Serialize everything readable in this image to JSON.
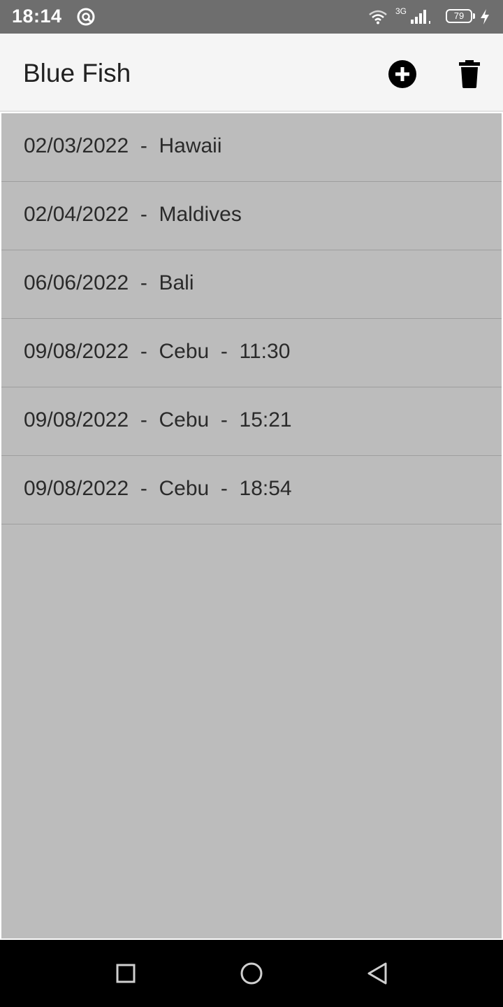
{
  "status_bar": {
    "time": "18:14",
    "network_type": "3G",
    "battery_level": "79",
    "icons": [
      "wifi-icon",
      "signal-icon",
      "battery-icon",
      "charging-icon",
      "app-notification-icon"
    ]
  },
  "app_bar": {
    "title": "Blue Fish",
    "actions": [
      {
        "name": "add",
        "icon": "add-circle-icon"
      },
      {
        "name": "delete",
        "icon": "trash-icon"
      }
    ]
  },
  "list": {
    "items": [
      {
        "label": "02/03/2022  -  Hawaii"
      },
      {
        "label": "02/04/2022  -  Maldives"
      },
      {
        "label": "06/06/2022  -  Bali"
      },
      {
        "label": "09/08/2022  -  Cebu  -  11:30"
      },
      {
        "label": "09/08/2022  -  Cebu  -  15:21"
      },
      {
        "label": "09/08/2022  -  Cebu  -  18:54"
      }
    ]
  },
  "nav_bar": {
    "buttons": [
      "recents-icon",
      "home-icon",
      "back-icon"
    ]
  },
  "colors": {
    "status_bar": "#6e6e6e",
    "app_bar": "#f5f5f5",
    "list_background": "#bcbcbc",
    "nav_bar": "#000000"
  }
}
